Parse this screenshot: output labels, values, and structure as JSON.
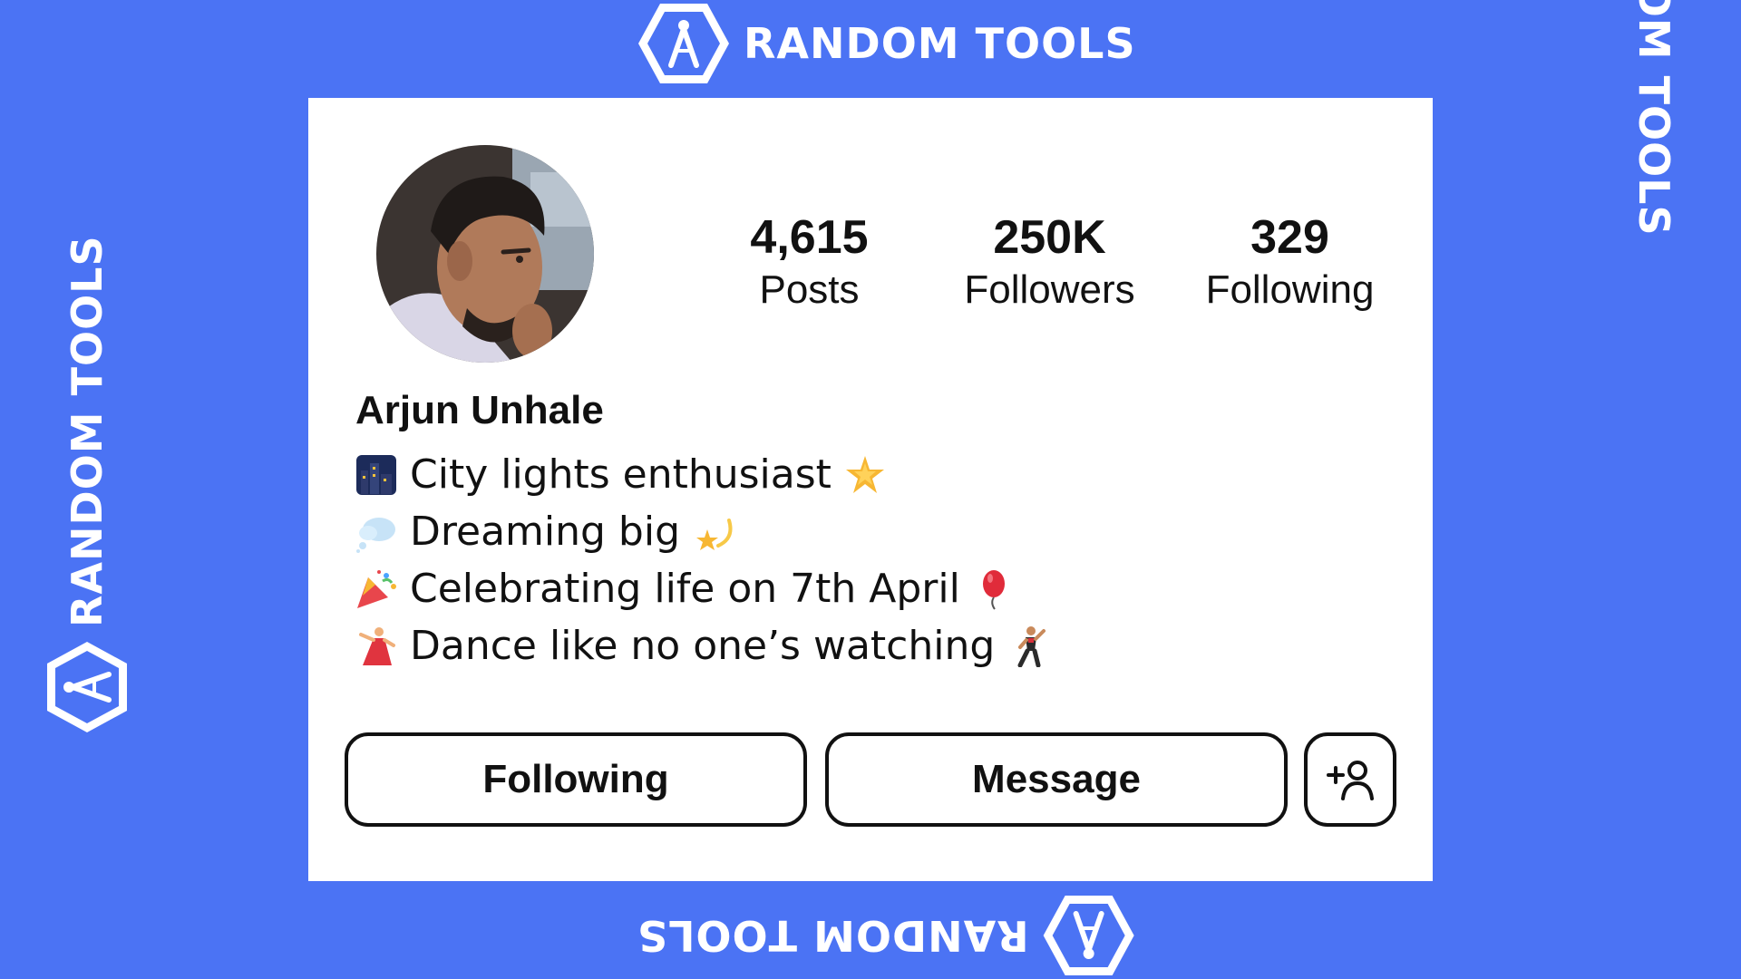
{
  "brand": {
    "name": "RANDOM TOOLS",
    "color": "#4b73f4"
  },
  "profile": {
    "name": "Arjun Unhale",
    "avatar_icon": "profile-photo",
    "stats": [
      {
        "value": "4,615",
        "label": "Posts"
      },
      {
        "value": "250K",
        "label": "Followers"
      },
      {
        "value": "329",
        "label": "Following"
      }
    ],
    "bio": [
      {
        "lead_icon": "night-city-emoji",
        "text": "City lights enthusiast",
        "trail_icon": "glowing-star-emoji"
      },
      {
        "lead_icon": "thought-bubble-emoji",
        "text": "Dreaming big",
        "trail_icon": "dizzy-star-emoji"
      },
      {
        "lead_icon": "party-popper-emoji",
        "text": "Celebrating life on 7th April",
        "trail_icon": "balloon-emoji"
      },
      {
        "lead_icon": "dancer-emoji",
        "text": "Dance like no one’s watching",
        "trail_icon": "man-dancing-emoji"
      }
    ]
  },
  "actions": {
    "following_label": "Following",
    "message_label": "Message",
    "add_user_icon": "add-user-icon"
  }
}
